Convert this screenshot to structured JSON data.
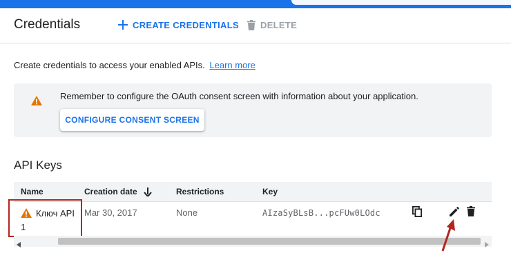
{
  "header": {
    "title": "Credentials",
    "create_label": "CREATE CREDENTIALS",
    "delete_label": "DELETE"
  },
  "intro": {
    "text": "Create credentials to access your enabled APIs.",
    "link": "Learn more"
  },
  "banner": {
    "text": "Remember to configure the OAuth consent screen with information about your application.",
    "button_label": "CONFIGURE CONSENT SCREEN"
  },
  "api_keys": {
    "title": "API Keys",
    "columns": [
      "Name",
      "Creation date",
      "Restrictions",
      "Key"
    ],
    "rows": [
      {
        "name": "Ключ API 1",
        "creation_date": "Mar 30, 2017",
        "restrictions": "None",
        "key": "AIzaSyBLsB...pcFUw0LOdc"
      }
    ]
  },
  "icons": {
    "create": "plus-icon",
    "delete": "trash-icon",
    "warning": "warning-icon",
    "sort": "arrow-down-icon",
    "copy": "copy-icon",
    "edit": "pencil-icon",
    "row_delete": "trash-icon"
  },
  "colors": {
    "accent": "#1a73e8",
    "warning": "#e37400",
    "highlight": "#b3261e",
    "banner_bg": "#f1f3f4"
  }
}
